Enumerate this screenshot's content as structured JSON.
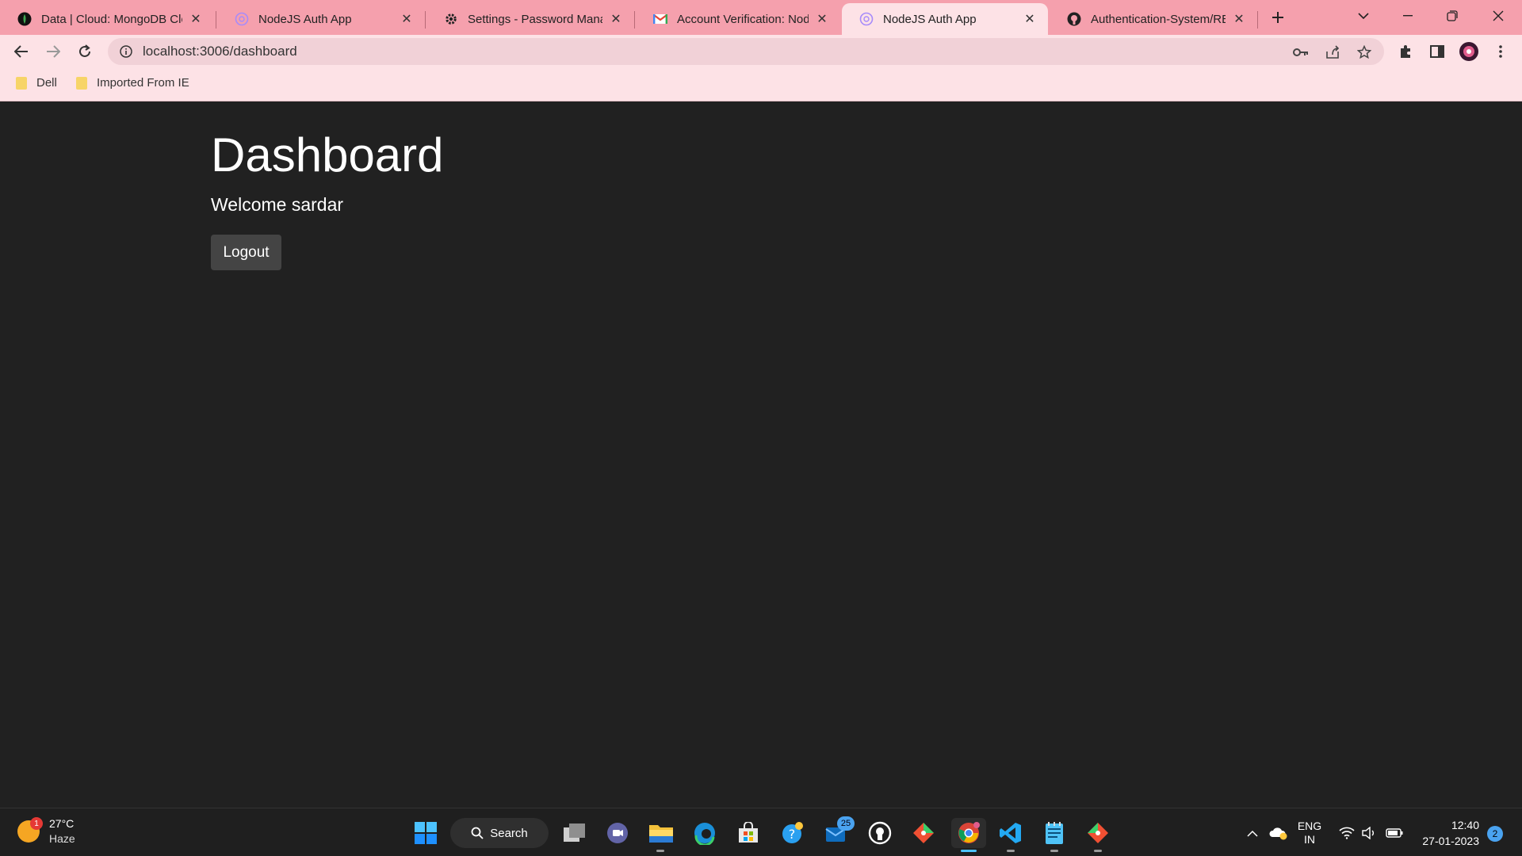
{
  "browser": {
    "tabs": [
      {
        "title": "Data | Cloud: MongoDB Clo",
        "icon": "mongodb-leaf-icon",
        "active": false
      },
      {
        "title": "NodeJS Auth App",
        "icon": "app-globe-icon",
        "active": false
      },
      {
        "title": "Settings - Password Manage",
        "icon": "settings-gear-icon",
        "active": false
      },
      {
        "title": "Account Verification: NodeJ",
        "icon": "gmail-icon",
        "active": false
      },
      {
        "title": "NodeJS Auth App",
        "icon": "app-globe-icon",
        "active": true
      },
      {
        "title": "Authentication-System/REA",
        "icon": "github-icon",
        "active": false
      }
    ],
    "url": "localhost:3006/dashboard",
    "bookmarks": [
      {
        "label": "Dell",
        "icon": "folder-icon"
      },
      {
        "label": "Imported From IE",
        "icon": "folder-icon"
      }
    ],
    "colors": {
      "tabstrip": "#f5a0ad",
      "toolbar": "#fde2e6",
      "omnibox": "#f1d1d7"
    }
  },
  "page": {
    "title": "Dashboard",
    "welcome": "Welcome sardar",
    "logout_label": "Logout",
    "colors": {
      "background": "#212121",
      "button": "#444444",
      "text": "#ffffff"
    }
  },
  "taskbar": {
    "weather": {
      "temp": "27°C",
      "condition": "Haze",
      "alert_count": "1"
    },
    "search_label": "Search",
    "mail_badge": "25",
    "tray": {
      "lang": "ENG",
      "region": "IN"
    },
    "clock": {
      "time": "12:40",
      "date": "27-01-2023"
    },
    "notification_count": "2"
  }
}
